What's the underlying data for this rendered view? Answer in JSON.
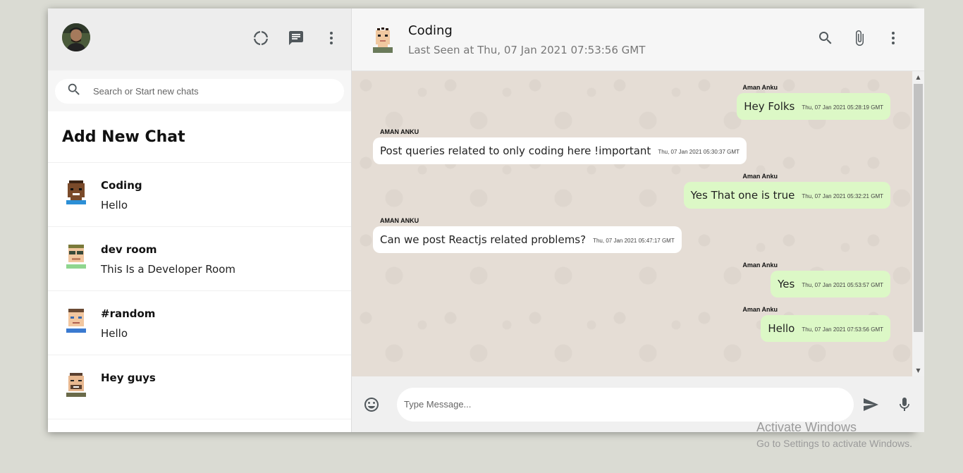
{
  "sidebar": {
    "search_placeholder": "Search or Start new chats",
    "add_new_chat": "Add New Chat",
    "chats": [
      {
        "name": "Coding",
        "last": "Hello"
      },
      {
        "name": "dev room",
        "last": "This Is a Developer Room"
      },
      {
        "name": "#random",
        "last": "Hello"
      },
      {
        "name": "Hey guys",
        "last": ""
      }
    ]
  },
  "header": {
    "room_name": "Coding",
    "last_seen": "Last Seen at Thu, 07 Jan 2021 07:53:56 GMT"
  },
  "messages": [
    {
      "direction": "sent",
      "sender": "Aman Anku",
      "text": "Hey Folks",
      "time": "Thu, 07 Jan 2021 05:28:19 GMT"
    },
    {
      "direction": "received",
      "sender": "Aman Anku",
      "text": "Post queries related to only coding here !important",
      "time": "Thu, 07 Jan 2021 05:30:37 GMT"
    },
    {
      "direction": "sent",
      "sender": "Aman Anku",
      "text": "Yes That one is true",
      "time": "Thu, 07 Jan 2021 05:32:21 GMT"
    },
    {
      "direction": "received",
      "sender": "Aman Anku",
      "text": "Can we post Reactjs related problems?",
      "time": "Thu, 07 Jan 2021 05:47:17 GMT"
    },
    {
      "direction": "sent",
      "sender": "Aman Anku",
      "text": "Yes",
      "time": "Thu, 07 Jan 2021 05:53:57 GMT"
    },
    {
      "direction": "sent",
      "sender": "Aman Anku",
      "text": "Hello",
      "time": "Thu, 07 Jan 2021 07:53:56 GMT"
    }
  ],
  "footer": {
    "message_placeholder": "Type Message..."
  },
  "watermark": {
    "title": "Activate Windows",
    "subtitle": "Go to Settings to activate Windows."
  },
  "colors": {
    "sent_bubble": "#dcf8c6",
    "received_bubble": "#ffffff",
    "chat_background": "#e5ddd5",
    "page_background": "#dadbd3"
  }
}
